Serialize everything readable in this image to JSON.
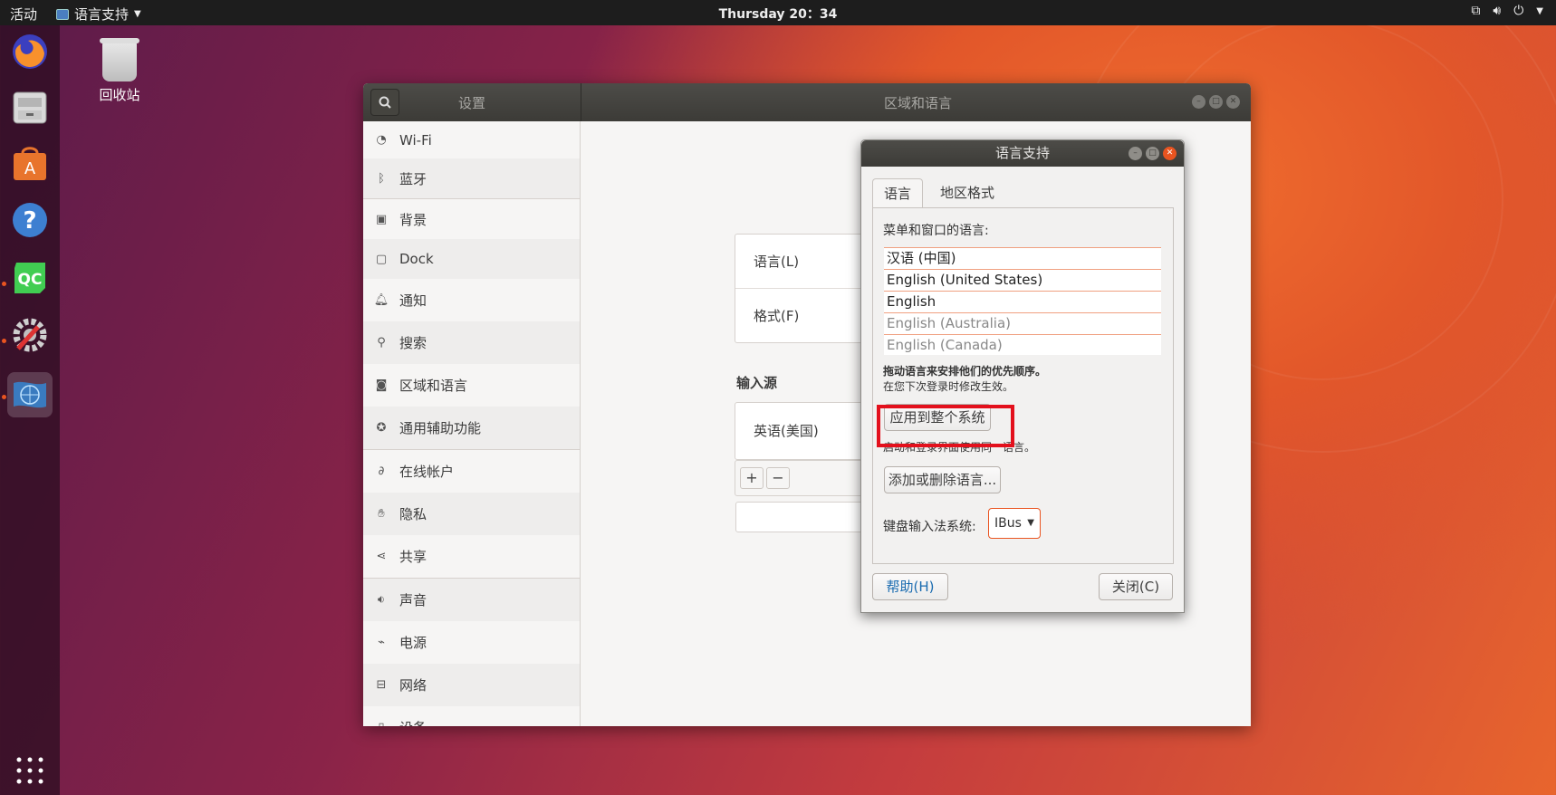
{
  "topbar": {
    "activities": "活动",
    "app_menu": "语言支持",
    "clock": "Thursday 20：34"
  },
  "desktop": {
    "trash_label": "回收站"
  },
  "dock": {
    "items": [
      "firefox-icon",
      "files-icon",
      "software-icon",
      "help-icon",
      "qt-creator-icon",
      "system-tools-icon",
      "language-support-icon",
      "app-grid-icon"
    ]
  },
  "settings": {
    "left_title": "设置",
    "main_title": "区域和语言",
    "sidebar": [
      {
        "label": "Wi-Fi",
        "icon": "wifi-icon"
      },
      {
        "label": "蓝牙",
        "icon": "bluetooth-icon"
      },
      {
        "label": "背景",
        "icon": "background-icon"
      },
      {
        "label": "Dock",
        "icon": "dock-icon"
      },
      {
        "label": "通知",
        "icon": "bell-icon"
      },
      {
        "label": "搜索",
        "icon": "search-icon"
      },
      {
        "label": "区域和语言",
        "icon": "camera-icon"
      },
      {
        "label": "通用辅助功能",
        "icon": "accessibility-icon"
      },
      {
        "label": "在线帐户",
        "icon": "online-accounts-icon"
      },
      {
        "label": "隐私",
        "icon": "hand-icon"
      },
      {
        "label": "共享",
        "icon": "share-icon"
      },
      {
        "label": "声音",
        "icon": "speaker-icon"
      },
      {
        "label": "电源",
        "icon": "power-icon"
      },
      {
        "label": "网络",
        "icon": "network-icon"
      },
      {
        "label": "设备",
        "icon": "device-icon"
      }
    ],
    "main": {
      "language_label": "语言(L)",
      "format_label": "格式(F)",
      "input_section": "输入源",
      "input_item": "英语(美国)",
      "add": "+",
      "remove": "−"
    }
  },
  "dialog": {
    "title": "语言支持",
    "tabs": [
      "语言",
      "地区格式"
    ],
    "menu_lang_label": "菜单和窗口的语言:",
    "languages": [
      "汉语 (中国)",
      "English (United States)",
      "English",
      "English (Australia)",
      "English (Canada)"
    ],
    "drag_hint": "拖动语言来安排他们的优先顺序。",
    "login_hint": "在您下次登录时修改生效。",
    "apply_system": "应用到整个系统",
    "apply_hint": "启动和登录界面使用同一语言。",
    "add_remove": "添加或删除语言...",
    "keyboard_label": "键盘输入法系统:",
    "keyboard_value": "IBus",
    "help": "帮助(H)",
    "close": "关闭(C)"
  },
  "colors": {
    "accent": "#e95420",
    "highlight_box": "#e3101c"
  }
}
